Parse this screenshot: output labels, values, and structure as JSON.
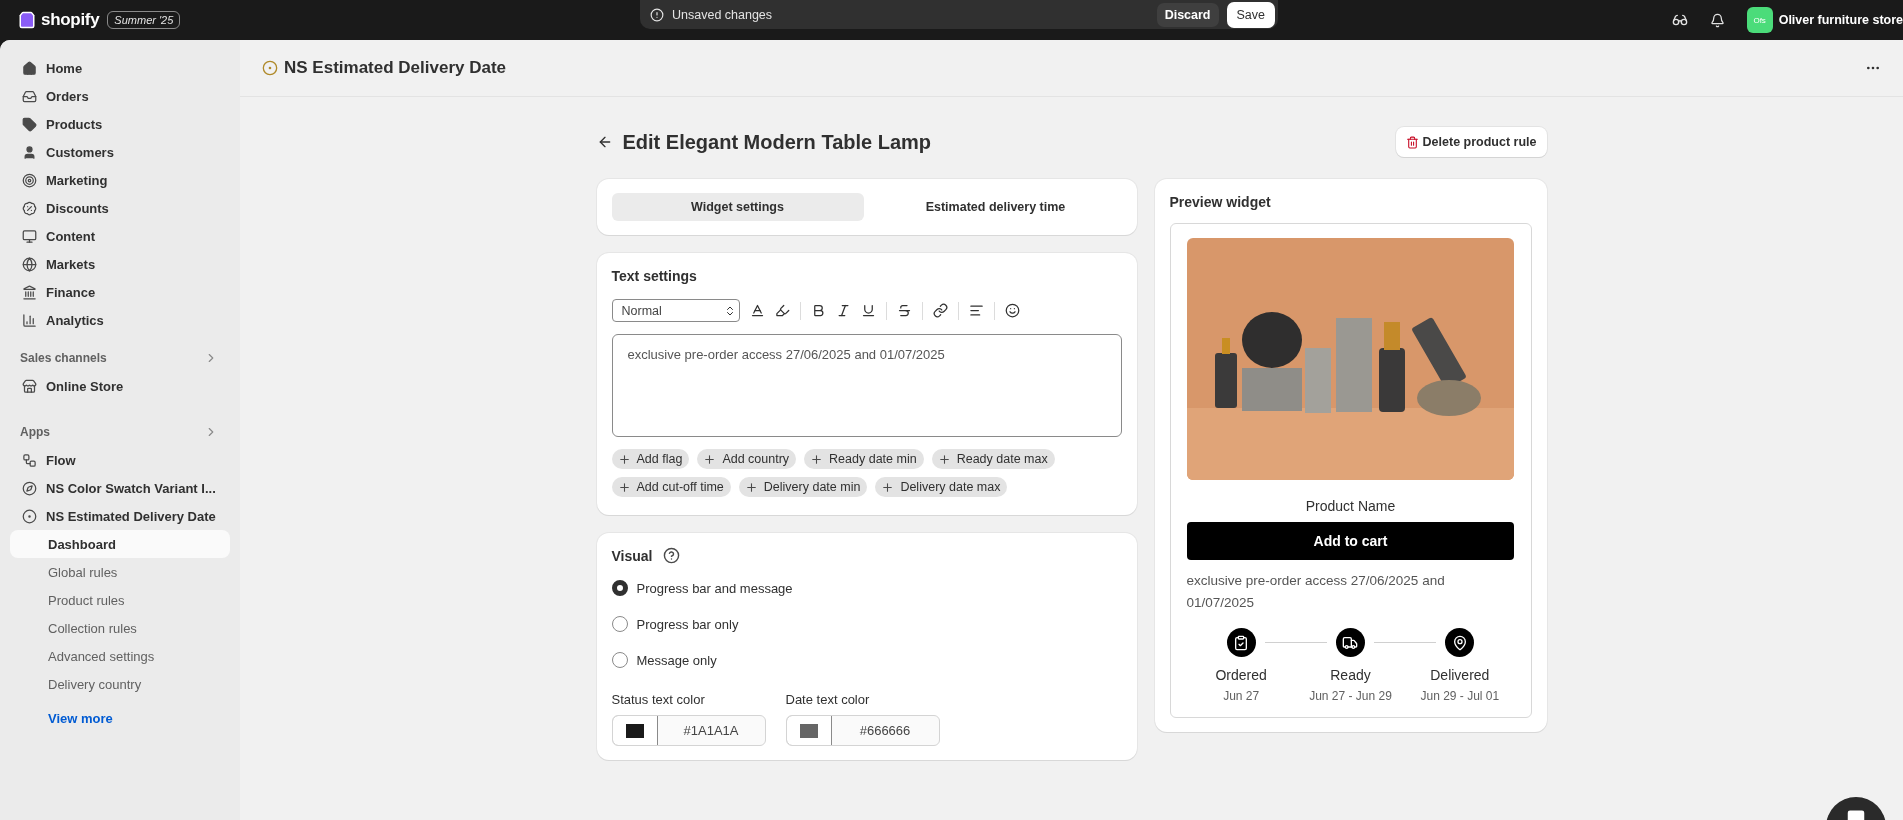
{
  "topbar": {
    "brand": "shopify",
    "badge": "Summer '25",
    "unsaved": {
      "message": "Unsaved changes",
      "discard": "Discard",
      "save": "Save"
    },
    "store": {
      "avatar": "Ofs",
      "name": "Oliver furniture store"
    }
  },
  "sidebar": {
    "items": [
      {
        "label": "Home"
      },
      {
        "label": "Orders"
      },
      {
        "label": "Products"
      },
      {
        "label": "Customers"
      },
      {
        "label": "Marketing"
      },
      {
        "label": "Discounts"
      },
      {
        "label": "Content"
      },
      {
        "label": "Markets"
      },
      {
        "label": "Finance"
      },
      {
        "label": "Analytics"
      }
    ],
    "sales_channels": {
      "title": "Sales channels",
      "items": [
        {
          "label": "Online Store"
        }
      ]
    },
    "apps": {
      "title": "Apps",
      "items": [
        {
          "label": "Flow"
        },
        {
          "label": "NS Color Swatch Variant I..."
        },
        {
          "label": "NS Estimated Delivery Date",
          "children": [
            {
              "label": "Dashboard",
              "selected": true
            },
            {
              "label": "Global rules",
              "selected": false
            },
            {
              "label": "Product rules",
              "selected": false
            },
            {
              "label": "Collection rules",
              "selected": false
            },
            {
              "label": "Advanced settings",
              "selected": false
            },
            {
              "label": "Delivery country",
              "selected": false
            }
          ]
        }
      ]
    },
    "view_more": "View more"
  },
  "header": {
    "app_title": "NS Estimated Delivery Date"
  },
  "page": {
    "title": "Edit Elegant Modern Table Lamp",
    "delete_button": "Delete product rule"
  },
  "tabs": [
    {
      "label": "Widget settings",
      "selected": true
    },
    {
      "label": "Estimated delivery time",
      "selected": false
    }
  ],
  "text_settings": {
    "title": "Text settings",
    "format": "Normal",
    "editor_value": "exclusive pre-order access 27/06/2025 and 01/07/2025",
    "tags": [
      "Add flag",
      "Add country",
      "Ready date min",
      "Ready date max",
      "Add cut-off time",
      "Delivery date min",
      "Delivery date max"
    ]
  },
  "visual": {
    "title": "Visual",
    "options": [
      {
        "label": "Progress bar and message",
        "selected": true
      },
      {
        "label": "Progress bar only",
        "selected": false
      },
      {
        "label": "Message only",
        "selected": false
      }
    ],
    "colors": [
      {
        "label": "Status text color",
        "value": "#1A1A1A",
        "color": "#1a1a1a"
      },
      {
        "label": "Date text color",
        "value": "#666666",
        "color": "#666666"
      }
    ]
  },
  "preview": {
    "title": "Preview widget",
    "product_name": "Product Name",
    "button": "Add to cart",
    "message": "exclusive pre-order access 27/06/2025 and 01/07/2025",
    "steps": [
      {
        "label": "Ordered",
        "date": "Jun 27"
      },
      {
        "label": "Ready",
        "date": "Jun 27 - Jun 29"
      },
      {
        "label": "Delivered",
        "date": "Jun 29 - Jul 01"
      }
    ]
  }
}
